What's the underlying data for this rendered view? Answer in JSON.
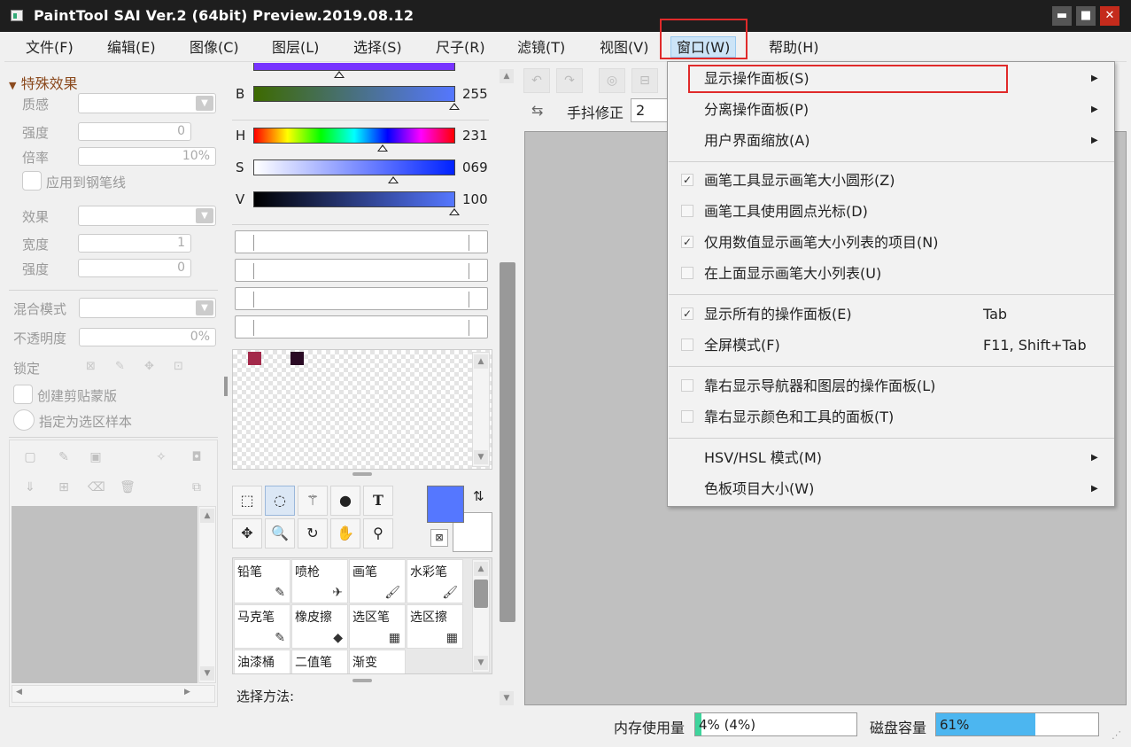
{
  "window": {
    "title": "PaintTool SAI Ver.2 (64bit) Preview.2019.08.12",
    "min_glyph": "▬",
    "max_glyph": "■",
    "close_glyph": "✕"
  },
  "menubar": [
    {
      "label": "文件(F)"
    },
    {
      "label": "编辑(E)"
    },
    {
      "label": "图像(C)"
    },
    {
      "label": "图层(L)"
    },
    {
      "label": "选择(S)"
    },
    {
      "label": "尺子(R)"
    },
    {
      "label": "滤镜(T)"
    },
    {
      "label": "视图(V)"
    },
    {
      "label": "窗口(W)"
    },
    {
      "label": "帮助(H)"
    }
  ],
  "left_panel": {
    "section_title": "特殊效果",
    "texture_label": "质感",
    "strength_label": "强度",
    "strength_value": "0",
    "scale_label": "倍率",
    "scale_value": "10%",
    "apply_pen_label": "应用到钢笔线",
    "effect_label": "效果",
    "width_label": "宽度",
    "width_value": "1",
    "strength2_label": "强度",
    "strength2_value": "0",
    "blend_label": "混合模式",
    "opacity_label": "不透明度",
    "opacity_value": "0%",
    "lock_label": "锁定",
    "clip_label": "创建剪贴蒙版",
    "sample_label": "指定为选区样本"
  },
  "color_panel": {
    "b_label": "B",
    "b_value": "255",
    "h_label": "H",
    "h_value": "231",
    "s_label": "S",
    "s_value": "069",
    "v_label": "V",
    "v_value": "100",
    "swatch_colors": [
      "#a3294a",
      "#2a0a24"
    ],
    "primary_color": "#5577ff",
    "secondary_color": "#ffffff"
  },
  "tools": {
    "brushes": [
      {
        "label": "铅笔",
        "icon": "✎"
      },
      {
        "label": "喷枪",
        "icon": "✈"
      },
      {
        "label": "画笔",
        "icon": "🖌"
      },
      {
        "label": "水彩笔",
        "icon": "🖌"
      },
      {
        "label": "马克笔",
        "icon": "✎"
      },
      {
        "label": "橡皮擦",
        "icon": "◆"
      },
      {
        "label": "选区笔",
        "icon": "▦"
      },
      {
        "label": "选区擦",
        "icon": "▦"
      },
      {
        "label": "油漆桶",
        "icon": ""
      },
      {
        "label": "二值笔",
        "icon": ""
      },
      {
        "label": "渐变",
        "icon": ""
      }
    ],
    "select_method_label": "选择方法:"
  },
  "canvas_toolbar": {
    "stabilizer_label": "手抖修正",
    "stabilizer_value": "2"
  },
  "status": {
    "memory_label": "内存使用量",
    "memory_text": "4% (4%)",
    "memory_pct": 4,
    "memory_color": "#3ed49c",
    "disk_label": "磁盘容量",
    "disk_text": "61%",
    "disk_pct": 61,
    "disk_color": "#4cb6f0"
  },
  "dropdown": {
    "items": [
      {
        "label": "显示操作面板(S)",
        "submenu": "▶"
      },
      {
        "label": "分离操作面板(P)",
        "submenu": "▶"
      },
      {
        "label": "用户界面缩放(A)",
        "submenu": "▶"
      },
      {
        "label": "画笔工具显示画笔大小圆形(Z)",
        "check": "✓"
      },
      {
        "label": "画笔工具使用圆点光标(D)",
        "check": ""
      },
      {
        "label": "仅用数值显示画笔大小列表的项目(N)",
        "check": "✓"
      },
      {
        "label": "在上面显示画笔大小列表(U)",
        "check": ""
      },
      {
        "label": "显示所有的操作面板(E)",
        "check": "✓",
        "shortcut": "Tab"
      },
      {
        "label": "全屏模式(F)",
        "check": "",
        "shortcut": "F11, Shift+Tab"
      },
      {
        "label": "靠右显示导航器和图层的操作面板(L)",
        "check": ""
      },
      {
        "label": "靠右显示颜色和工具的面板(T)",
        "check": ""
      },
      {
        "label": "HSV/HSL 模式(M)",
        "submenu": "▶"
      },
      {
        "label": "色板项目大小(W)",
        "submenu": "▶"
      }
    ]
  }
}
